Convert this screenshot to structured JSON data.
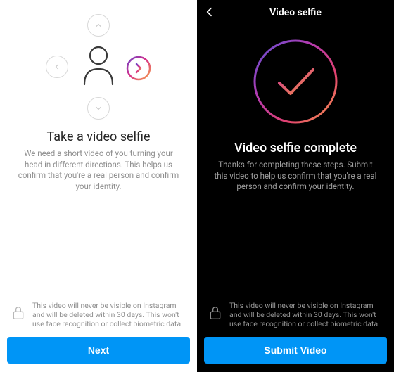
{
  "left": {
    "title": "Take a video selfie",
    "desc": "We need a short video of you turning your head in different directions. This helps us confirm that you're a real person and confirm your identity.",
    "privacy": "This video will never be visible on Instagram and will be deleted within 30 days. This won't use face recognition or collect biometric data.",
    "cta": "Next"
  },
  "right": {
    "header_title": "Video selfie",
    "title": "Video selfie complete",
    "desc": "Thanks for completing these steps. Submit this video to help us confirm that you're a real person and confirm your identity.",
    "privacy": "This video will never be visible on Instagram and will be deleted within 30 days. This won't use face recognition or collect biometric data.",
    "cta": "Submit Video"
  },
  "colors": {
    "primary": "#0095f6"
  }
}
